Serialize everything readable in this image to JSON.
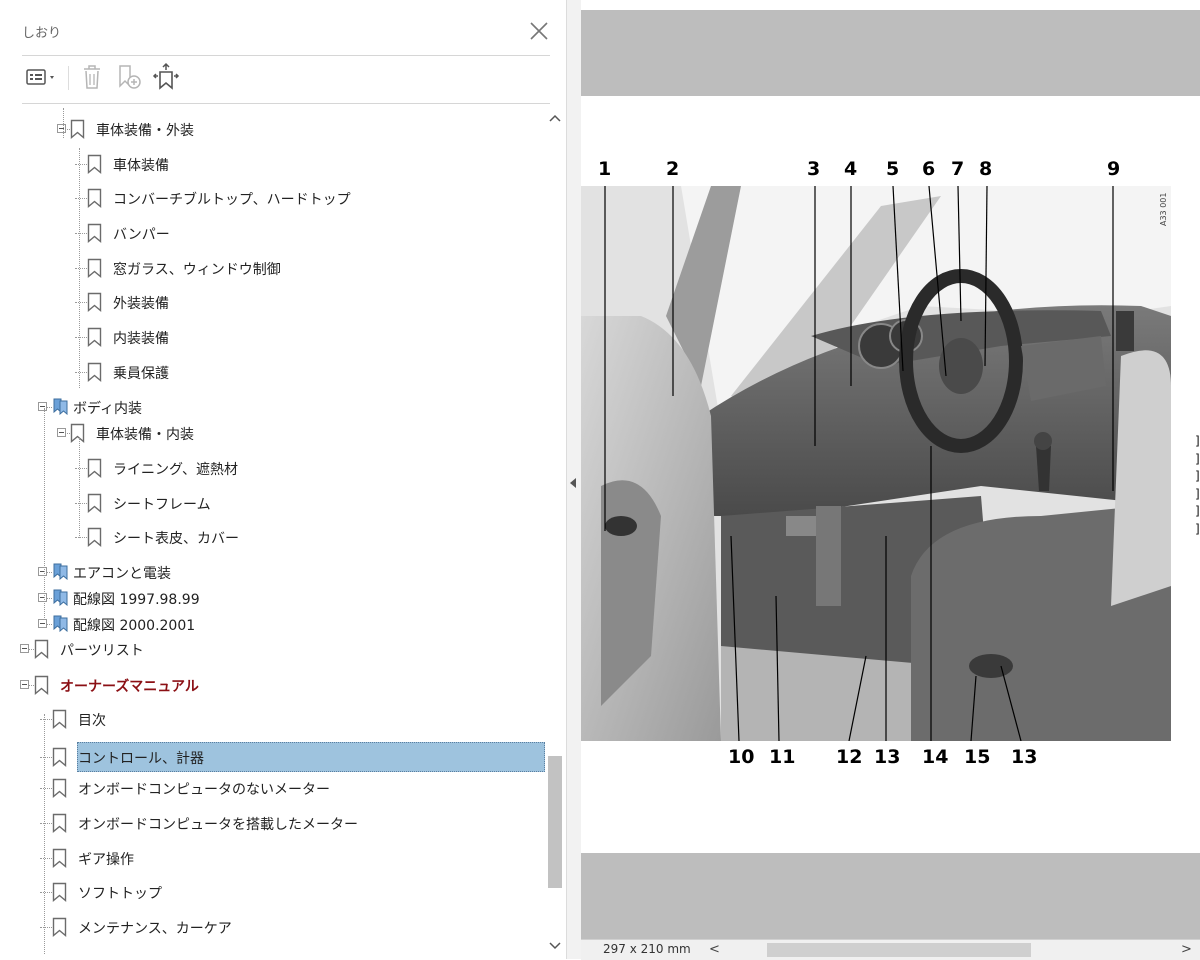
{
  "panel": {
    "title": "しおり",
    "close_icon": "close-x-icon",
    "toolbar": {
      "options_icon": "bookmark-options-icon",
      "delete_icon": "trash-icon",
      "new_bookmark_icon": "new-bookmark-icon",
      "expand_icon": "expand-bookmark-icon"
    },
    "bookmarks": [
      "車体装備・外装",
      "車体装備",
      "コンバーチブルトップ、ハードトップ",
      "バンパー",
      "窓ガラス、ウィンドウ制御",
      "外装装備",
      "内装装備",
      "乗員保護",
      "ボディ内装",
      "車体装備・内装",
      "ライニング、遮熱材",
      "シートフレーム",
      "シート表皮、カバー",
      "エアコンと電装",
      "配線図 1997.98.99",
      "配線図 2000.2001",
      "パーツリスト",
      "オーナーズマニュアル",
      "目次",
      "コントロール、計器",
      "オンボードコンピュータのないメーター",
      "オンボードコンピュータを搭載したメーター",
      "ギア操作",
      "ソフトトップ",
      "メンテナンス、カーケア"
    ],
    "selected": "コントロール、計器",
    "owner_color": "#8b0f14",
    "selection_color": "#9ec3de"
  },
  "document": {
    "callouts_top": [
      "1",
      "2",
      "3",
      "4",
      "5",
      "6",
      "7",
      "8",
      "9"
    ],
    "callouts_bottom": [
      "10",
      "11",
      "12",
      "13",
      "14",
      "15",
      "13"
    ],
    "figure_code": "A33 001",
    "page_size": "297 x 210 mm",
    "side_marks": [
      "]",
      "]",
      "]",
      "]",
      "]",
      "]"
    ]
  }
}
